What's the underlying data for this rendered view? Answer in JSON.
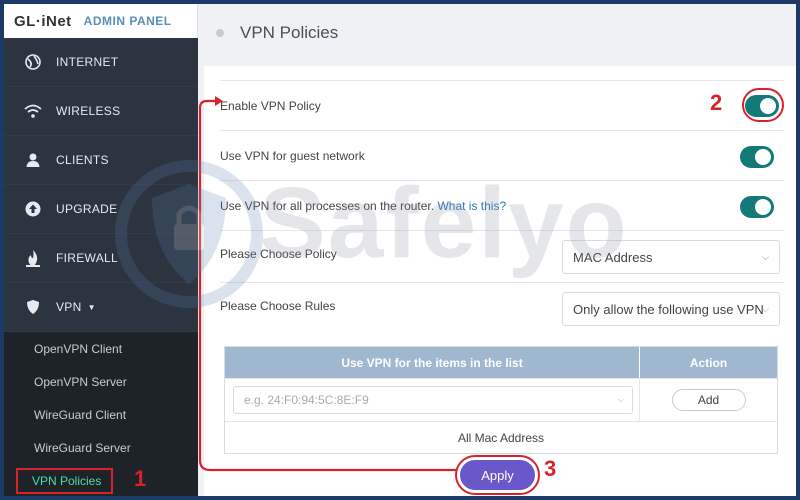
{
  "brand": {
    "logo": "GL·iNet",
    "panel_label": "ADMIN PANEL"
  },
  "sidebar": {
    "items": [
      {
        "label": "INTERNET",
        "icon": "globe-icon"
      },
      {
        "label": "WIRELESS",
        "icon": "wifi-icon"
      },
      {
        "label": "CLIENTS",
        "icon": "user-icon"
      },
      {
        "label": "UPGRADE",
        "icon": "upgrade-icon"
      },
      {
        "label": "FIREWALL",
        "icon": "fire-icon"
      },
      {
        "label": "VPN",
        "icon": "shield-icon"
      }
    ],
    "vpn_submenu": [
      {
        "label": "OpenVPN Client"
      },
      {
        "label": "OpenVPN Server"
      },
      {
        "label": "WireGuard Client"
      },
      {
        "label": "WireGuard Server"
      },
      {
        "label": "VPN Policies",
        "active": true
      }
    ]
  },
  "header": {
    "title": "VPN Policies"
  },
  "settings": {
    "enable_vpn_policy": {
      "label": "Enable VPN Policy",
      "enabled": true
    },
    "guest_network": {
      "label": "Use VPN for guest network",
      "enabled": true
    },
    "router_processes": {
      "label": "Use VPN for all processes on the router.",
      "link": "What is this?",
      "enabled": true
    },
    "choose_policy": {
      "label": "Please Choose Policy",
      "value": "MAC Address"
    },
    "choose_rules": {
      "label": "Please Choose Rules",
      "value": "Only allow the following use VPN"
    }
  },
  "table": {
    "headers": [
      "Use VPN for the items in the list",
      "Action"
    ],
    "input_placeholder": "e.g. 24:F0:94:5C:8E:F9",
    "add_label": "Add",
    "footer": "All Mac Address"
  },
  "apply_label": "Apply",
  "annotations": {
    "step1": "1",
    "step2": "2",
    "step3": "3",
    "color": "#d8232a"
  },
  "watermark": "Safelyo",
  "colors": {
    "toggle": "#137a78",
    "apply": "#6a57c9",
    "active_submenu": "#4fe0a0",
    "table_header": "#9fb7cf"
  }
}
